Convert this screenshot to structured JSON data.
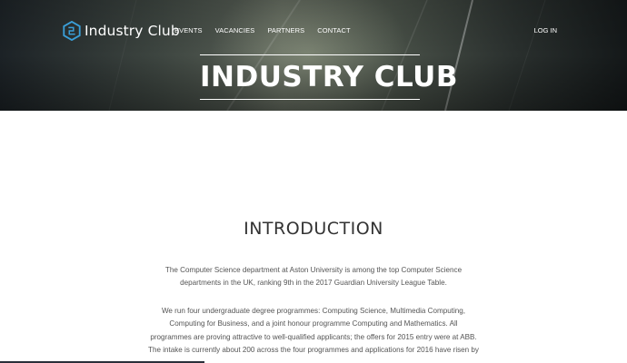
{
  "header": {
    "logo_text": "Industry Club",
    "nav": [
      "EVENTS",
      "VACANCIES",
      "PARTNERS",
      "CONTACT"
    ],
    "login": "LOG IN",
    "hero_title": "INDUSTRY CLUB"
  },
  "main": {
    "section_title": "INTRODUCTION",
    "paragraph1_lines": [
      "The Computer Science department at Aston University is among the top Computer Science",
      "departments in the UK, ranking 9th in the 2017 Guardian University League Table."
    ],
    "paragraph2_lines": [
      "We run four undergraduate degree programmes: Computing Science, Multimedia Computing,",
      "Computing for Business, and a joint honour programme Computing and Mathematics. All",
      "programmes are proving attractive to well-qualified applicants; the offers for 2015 entry were at ABB.",
      "The intake is currently about 200 across the four programmes and applications for 2016 have risen by"
    ]
  },
  "colors": {
    "accent": "#3a9fd8",
    "text": "#555555",
    "title": "#333333"
  },
  "icons": {
    "logo": "hexagon-logo-icon"
  }
}
